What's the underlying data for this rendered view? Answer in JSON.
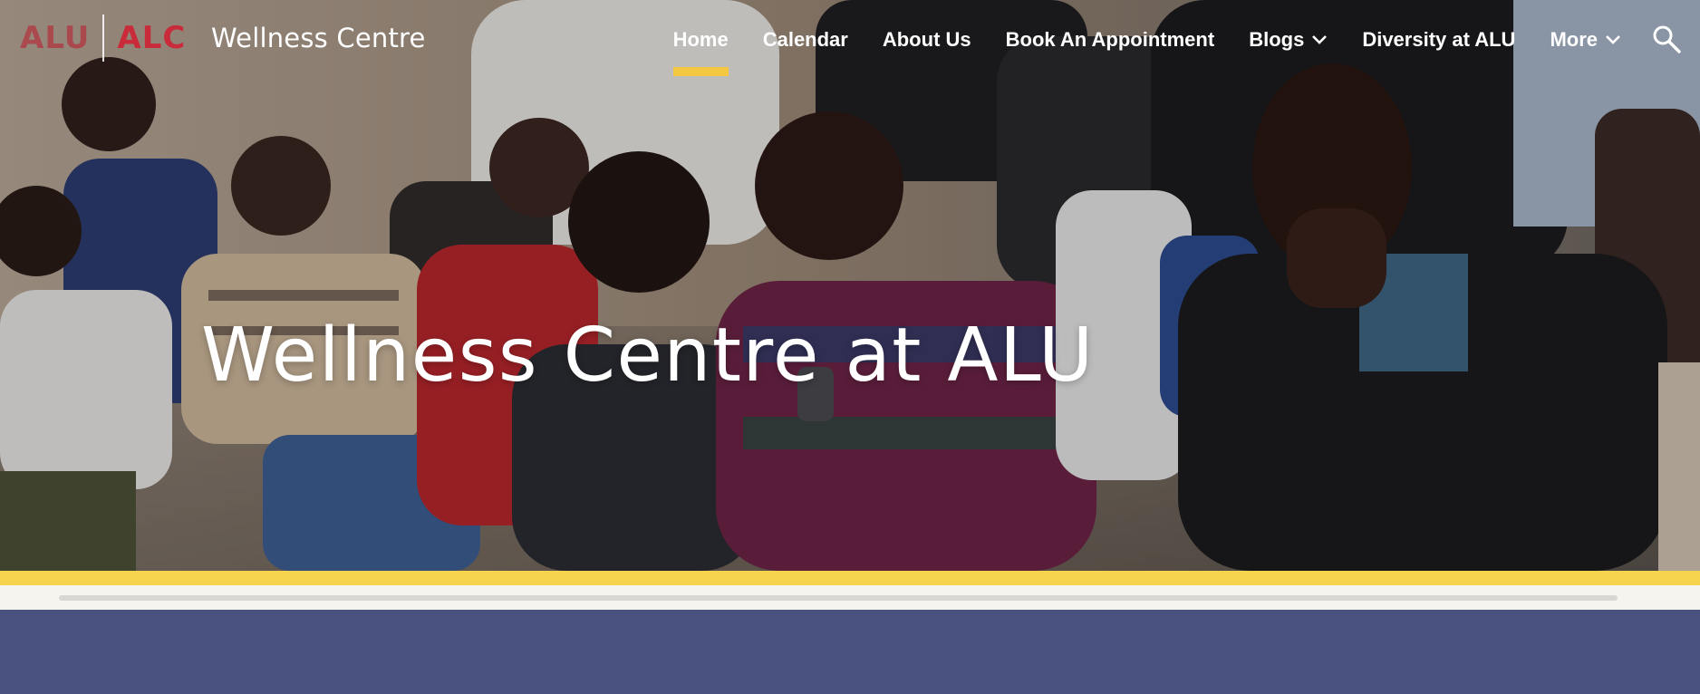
{
  "header": {
    "logo": {
      "part1": "ALU",
      "part2": "ALC"
    },
    "site_title": "Wellness Centre",
    "nav": [
      {
        "label": "Home",
        "active": true,
        "dropdown": false
      },
      {
        "label": "Calendar",
        "active": false,
        "dropdown": false
      },
      {
        "label": "About Us",
        "active": false,
        "dropdown": false
      },
      {
        "label": "Book An Appointment",
        "active": false,
        "dropdown": false
      },
      {
        "label": "Blogs",
        "active": false,
        "dropdown": true
      },
      {
        "label": "Diversity at ALU",
        "active": false,
        "dropdown": false
      },
      {
        "label": "More",
        "active": false,
        "dropdown": true
      }
    ],
    "search_icon": "search-icon"
  },
  "hero": {
    "headline": "Wellness Centre at ALU",
    "image": "audience-photo"
  },
  "colors": {
    "accent_yellow": "#f7d44e",
    "band_indigo": "#4a5380",
    "logo_red": "#c92b3a"
  }
}
